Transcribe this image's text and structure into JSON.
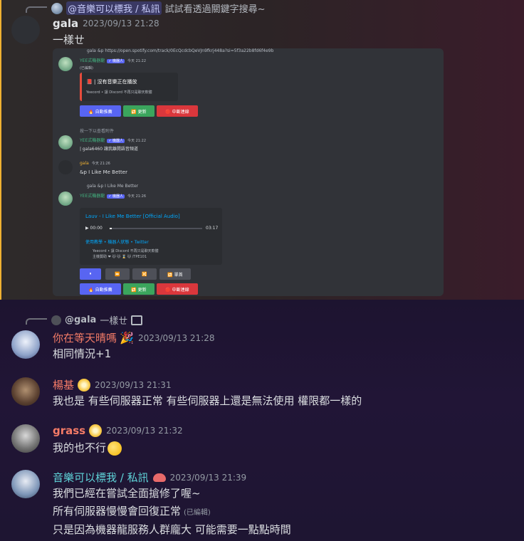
{
  "top_message": {
    "reply": {
      "mention": "@音樂可以標我 / 私訊",
      "text": "試試看透過關鍵字搜尋~"
    },
    "author": "gala",
    "timestamp": "2023/09/13 21:28",
    "text": "一樣ㄝ",
    "colors": {
      "author": "#e3e5e8",
      "highlight_bar": "#f0b132"
    }
  },
  "screenshot": {
    "m1": {
      "reply_author": "gala",
      "reply_cmd": "&p https://open.spotify.com/track/0EcQcdcbQeVJn9fkrj448a?si=5f3a22b8fd6f4e9b",
      "bot": "YEE式機器龍",
      "bot_tag": "✓ 機器人",
      "time": "今天 21:22",
      "edited_tag": "(已編輯)",
      "embed_title": "📕 | 沒有音樂正在播放",
      "embed_footer": "Yeecord • 讓 Discord 不再只是聊天軟體"
    },
    "buttons": {
      "auto": "🔥 自動推薦",
      "refresh": "🔁 更新",
      "stop": "🛑 中斷連線"
    },
    "m2": {
      "reply_text": "按一下以查看附件",
      "bot": "YEE式機器龍",
      "bot_tag": "✓ 機器人",
      "time": "今天 21:22",
      "text": "| gala6460 讓我離開語音頻道"
    },
    "m3": {
      "author": "gala",
      "time": "今天 21:26",
      "text": "&p I Like Me Better"
    },
    "m4": {
      "reply_author": "gala",
      "reply_text": "&p I Like Me Better",
      "bot": "YEE式機器龍",
      "bot_tag": "✓ 機器人",
      "time": "今天 21:26",
      "track_title": "Lauv - I Like Me Better [Official Audio]",
      "elapsed": "00:00",
      "duration": "03:17",
      "progress": 0.0,
      "links": "使用教學 • 機器人狀態 • Twitter",
      "footer1": "Yeecord • 讓 Discord 不再只是聊天軟體",
      "footer2": "主機贊助 ❤ 🐱 🐱 ⌛ 🐱 /TPE101",
      "ctrl": {
        "pause": "⏸",
        "skip": "⏩",
        "shuffle": "🔀",
        "loop": "🔂 單首"
      }
    }
  },
  "messages": [
    {
      "reply": {
        "mention": "@gala",
        "text": "一樣ㄝ"
      },
      "author": "你在等天晴嗎",
      "author_color": "#f47b67",
      "timestamp": "2023/09/13 21:28",
      "lines": [
        "相同情況+1"
      ]
    },
    {
      "author": "楊基",
      "author_color": "#f47b67",
      "timestamp": "2023/09/13 21:31",
      "lines": [
        "我也是 有些伺服器正常 有些伺服器上還是無法使用 權限都一樣的"
      ]
    },
    {
      "author": "grass",
      "author_color": "#f47b67",
      "timestamp": "2023/09/13 21:32",
      "lines": [
        "我的也不行"
      ]
    },
    {
      "author": "音樂可以標我 / 私訊",
      "author_color": "#5fd4d9",
      "timestamp": "2023/09/13 21:39",
      "lines": [
        "我們已經在嘗試全面搶修了喔~",
        "所有伺服器慢慢會回復正常",
        "只是因為機器龍服務人群龐大 可能需要一點點時間"
      ],
      "edited": "(已編輯)"
    }
  ]
}
